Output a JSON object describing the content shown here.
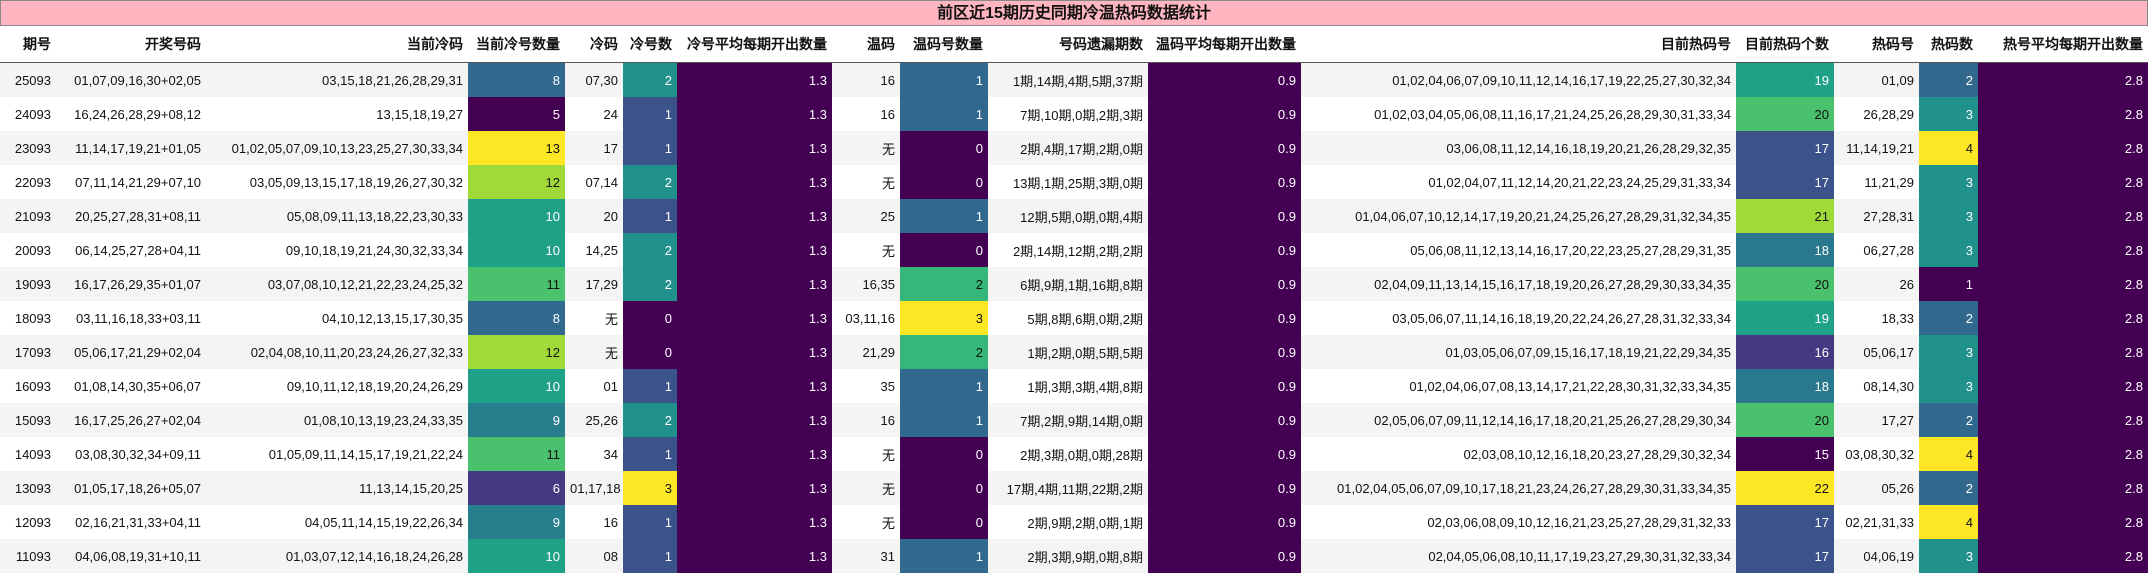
{
  "title": "前区近15期历史同期冷温热码数据统计",
  "columns": [
    "期号",
    "开奖号码",
    "当前冷码",
    "当前冷号数量",
    "冷码",
    "冷号数",
    "冷号平均每期开出数量",
    "温码",
    "温码号数量",
    "号码遗漏期数",
    "温码平均每期开出数量",
    "目前热码号",
    "目前热码个数",
    "热码号",
    "热码数",
    "热号平均每期开出数量"
  ],
  "rows": [
    [
      "25093",
      "01,07,09,16,30+02,05",
      "03,15,18,21,26,28,29,31",
      "8",
      "07,30",
      "2",
      "1.3",
      "16",
      "1",
      "1期,14期,4期,5期,37期",
      "0.9",
      "01,02,04,06,07,09,10,11,12,14,16,17,19,22,25,27,30,32,34",
      "19",
      "01,09",
      "2",
      "2.8"
    ],
    [
      "24093",
      "16,24,26,28,29+08,12",
      "13,15,18,19,27",
      "5",
      "24",
      "1",
      "1.3",
      "16",
      "1",
      "7期,10期,0期,2期,3期",
      "0.9",
      "01,02,03,04,05,06,08,11,16,17,21,24,25,26,28,29,30,31,33,34",
      "20",
      "26,28,29",
      "3",
      "2.8"
    ],
    [
      "23093",
      "11,14,17,19,21+01,05",
      "01,02,05,07,09,10,13,23,25,27,30,33,34",
      "13",
      "17",
      "1",
      "1.3",
      "无",
      "0",
      "2期,4期,17期,2期,0期",
      "0.9",
      "03,06,08,11,12,14,16,18,19,20,21,26,28,29,32,35",
      "17",
      "11,14,19,21",
      "4",
      "2.8"
    ],
    [
      "22093",
      "07,11,14,21,29+07,10",
      "03,05,09,13,15,17,18,19,26,27,30,32",
      "12",
      "07,14",
      "2",
      "1.3",
      "无",
      "0",
      "13期,1期,25期,3期,0期",
      "0.9",
      "01,02,04,07,11,12,14,20,21,22,23,24,25,29,31,33,34",
      "17",
      "11,21,29",
      "3",
      "2.8"
    ],
    [
      "21093",
      "20,25,27,28,31+08,11",
      "05,08,09,11,13,18,22,23,30,33",
      "10",
      "20",
      "1",
      "1.3",
      "25",
      "1",
      "12期,5期,0期,0期,4期",
      "0.9",
      "01,04,06,07,10,12,14,17,19,20,21,24,25,26,27,28,29,31,32,34,35",
      "21",
      "27,28,31",
      "3",
      "2.8"
    ],
    [
      "20093",
      "06,14,25,27,28+04,11",
      "09,10,18,19,21,24,30,32,33,34",
      "10",
      "14,25",
      "2",
      "1.3",
      "无",
      "0",
      "2期,14期,12期,2期,2期",
      "0.9",
      "05,06,08,11,12,13,14,16,17,20,22,23,25,27,28,29,31,35",
      "18",
      "06,27,28",
      "3",
      "2.8"
    ],
    [
      "19093",
      "16,17,26,29,35+01,07",
      "03,07,08,10,12,21,22,23,24,25,32",
      "11",
      "17,29",
      "2",
      "1.3",
      "16,35",
      "2",
      "6期,9期,1期,16期,8期",
      "0.9",
      "02,04,09,11,13,14,15,16,17,18,19,20,26,27,28,29,30,33,34,35",
      "20",
      "26",
      "1",
      "2.8"
    ],
    [
      "18093",
      "03,11,16,18,33+03,11",
      "04,10,12,13,15,17,30,35",
      "8",
      "无",
      "0",
      "1.3",
      "03,11,16",
      "3",
      "5期,8期,6期,0期,2期",
      "0.9",
      "03,05,06,07,11,14,16,18,19,20,22,24,26,27,28,31,32,33,34",
      "19",
      "18,33",
      "2",
      "2.8"
    ],
    [
      "17093",
      "05,06,17,21,29+02,04",
      "02,04,08,10,11,20,23,24,26,27,32,33",
      "12",
      "无",
      "0",
      "1.3",
      "21,29",
      "2",
      "1期,2期,0期,5期,5期",
      "0.9",
      "01,03,05,06,07,09,15,16,17,18,19,21,22,29,34,35",
      "16",
      "05,06,17",
      "3",
      "2.8"
    ],
    [
      "16093",
      "01,08,14,30,35+06,07",
      "09,10,11,12,18,19,20,24,26,29",
      "10",
      "01",
      "1",
      "1.3",
      "35",
      "1",
      "1期,3期,3期,4期,8期",
      "0.9",
      "01,02,04,06,07,08,13,14,17,21,22,28,30,31,32,33,34,35",
      "18",
      "08,14,30",
      "3",
      "2.8"
    ],
    [
      "15093",
      "16,17,25,26,27+02,04",
      "01,08,10,13,19,23,24,33,35",
      "9",
      "25,26",
      "2",
      "1.3",
      "16",
      "1",
      "7期,2期,9期,14期,0期",
      "0.9",
      "02,05,06,07,09,11,12,14,16,17,18,20,21,25,26,27,28,29,30,34",
      "20",
      "17,27",
      "2",
      "2.8"
    ],
    [
      "14093",
      "03,08,30,32,34+09,11",
      "01,05,09,11,14,15,17,19,21,22,24",
      "11",
      "34",
      "1",
      "1.3",
      "无",
      "0",
      "2期,3期,0期,0期,28期",
      "0.9",
      "02,03,08,10,12,16,18,20,23,27,28,29,30,32,34",
      "15",
      "03,08,30,32",
      "4",
      "2.8"
    ],
    [
      "13093",
      "01,05,17,18,26+05,07",
      "11,13,14,15,20,25",
      "6",
      "01,17,18",
      "3",
      "1.3",
      "无",
      "0",
      "17期,4期,11期,22期,2期",
      "0.9",
      "01,02,04,05,06,07,09,10,17,18,21,23,24,26,27,28,29,30,31,33,34,35",
      "22",
      "05,26",
      "2",
      "2.8"
    ],
    [
      "12093",
      "02,16,21,31,33+04,11",
      "04,05,11,14,15,19,22,26,34",
      "9",
      "16",
      "1",
      "1.3",
      "无",
      "0",
      "2期,9期,2期,0期,1期",
      "0.9",
      "02,03,06,08,09,10,12,16,21,23,25,27,28,29,31,32,33",
      "17",
      "02,21,31,33",
      "4",
      "2.8"
    ],
    [
      "11093",
      "04,06,08,19,31+10,11",
      "01,03,07,12,14,16,18,24,26,28",
      "10",
      "08",
      "1",
      "1.3",
      "31",
      "1",
      "2期,3期,9期,0期,8期",
      "0.9",
      "02,04,05,06,08,10,11,17,19,23,27,29,30,31,32,33,34",
      "17",
      "04,06,19",
      "3",
      "2.8"
    ]
  ],
  "heat_colors": {
    "col3": [
      "#31688e",
      "#440154",
      "#fde725",
      "#a0da39",
      "#1fa187",
      "#1fa187",
      "#4ac16d",
      "#31688e",
      "#a0da39",
      "#1fa187",
      "#277f8e",
      "#4ac16d",
      "#443a83",
      "#277f8e",
      "#1fa187"
    ],
    "col5": [
      "#21918c",
      "#3b528b",
      "#3b528b",
      "#21918c",
      "#3b528b",
      "#21918c",
      "#21918c",
      "#440154",
      "#440154",
      "#3b528b",
      "#21918c",
      "#3b528b",
      "#fde725",
      "#3b528b",
      "#3b528b"
    ],
    "col6": "#440154",
    "col8": [
      "#31688e",
      "#31688e",
      "#440154",
      "#440154",
      "#31688e",
      "#440154",
      "#35b779",
      "#fde725",
      "#35b779",
      "#31688e",
      "#31688e",
      "#440154",
      "#440154",
      "#440154",
      "#31688e"
    ],
    "col10": "#440154",
    "col12": [
      "#1fa187",
      "#4ac16d",
      "#3b528b",
      "#3b528b",
      "#a0da39",
      "#2a788e",
      "#4ac16d",
      "#1fa187",
      "#443a83",
      "#2a788e",
      "#4ac16d",
      "#440154",
      "#fde725",
      "#3b528b",
      "#3b528b"
    ],
    "col14": [
      "#31688e",
      "#21918c",
      "#fde725",
      "#21918c",
      "#21918c",
      "#21918c",
      "#440154",
      "#31688e",
      "#21918c",
      "#21918c",
      "#31688e",
      "#fde725",
      "#31688e",
      "#fde725",
      "#21918c"
    ],
    "col15": "#440154",
    "light_text_on": [
      "#fde725",
      "#a0da39",
      "#4ac16d",
      "#35b779"
    ]
  }
}
